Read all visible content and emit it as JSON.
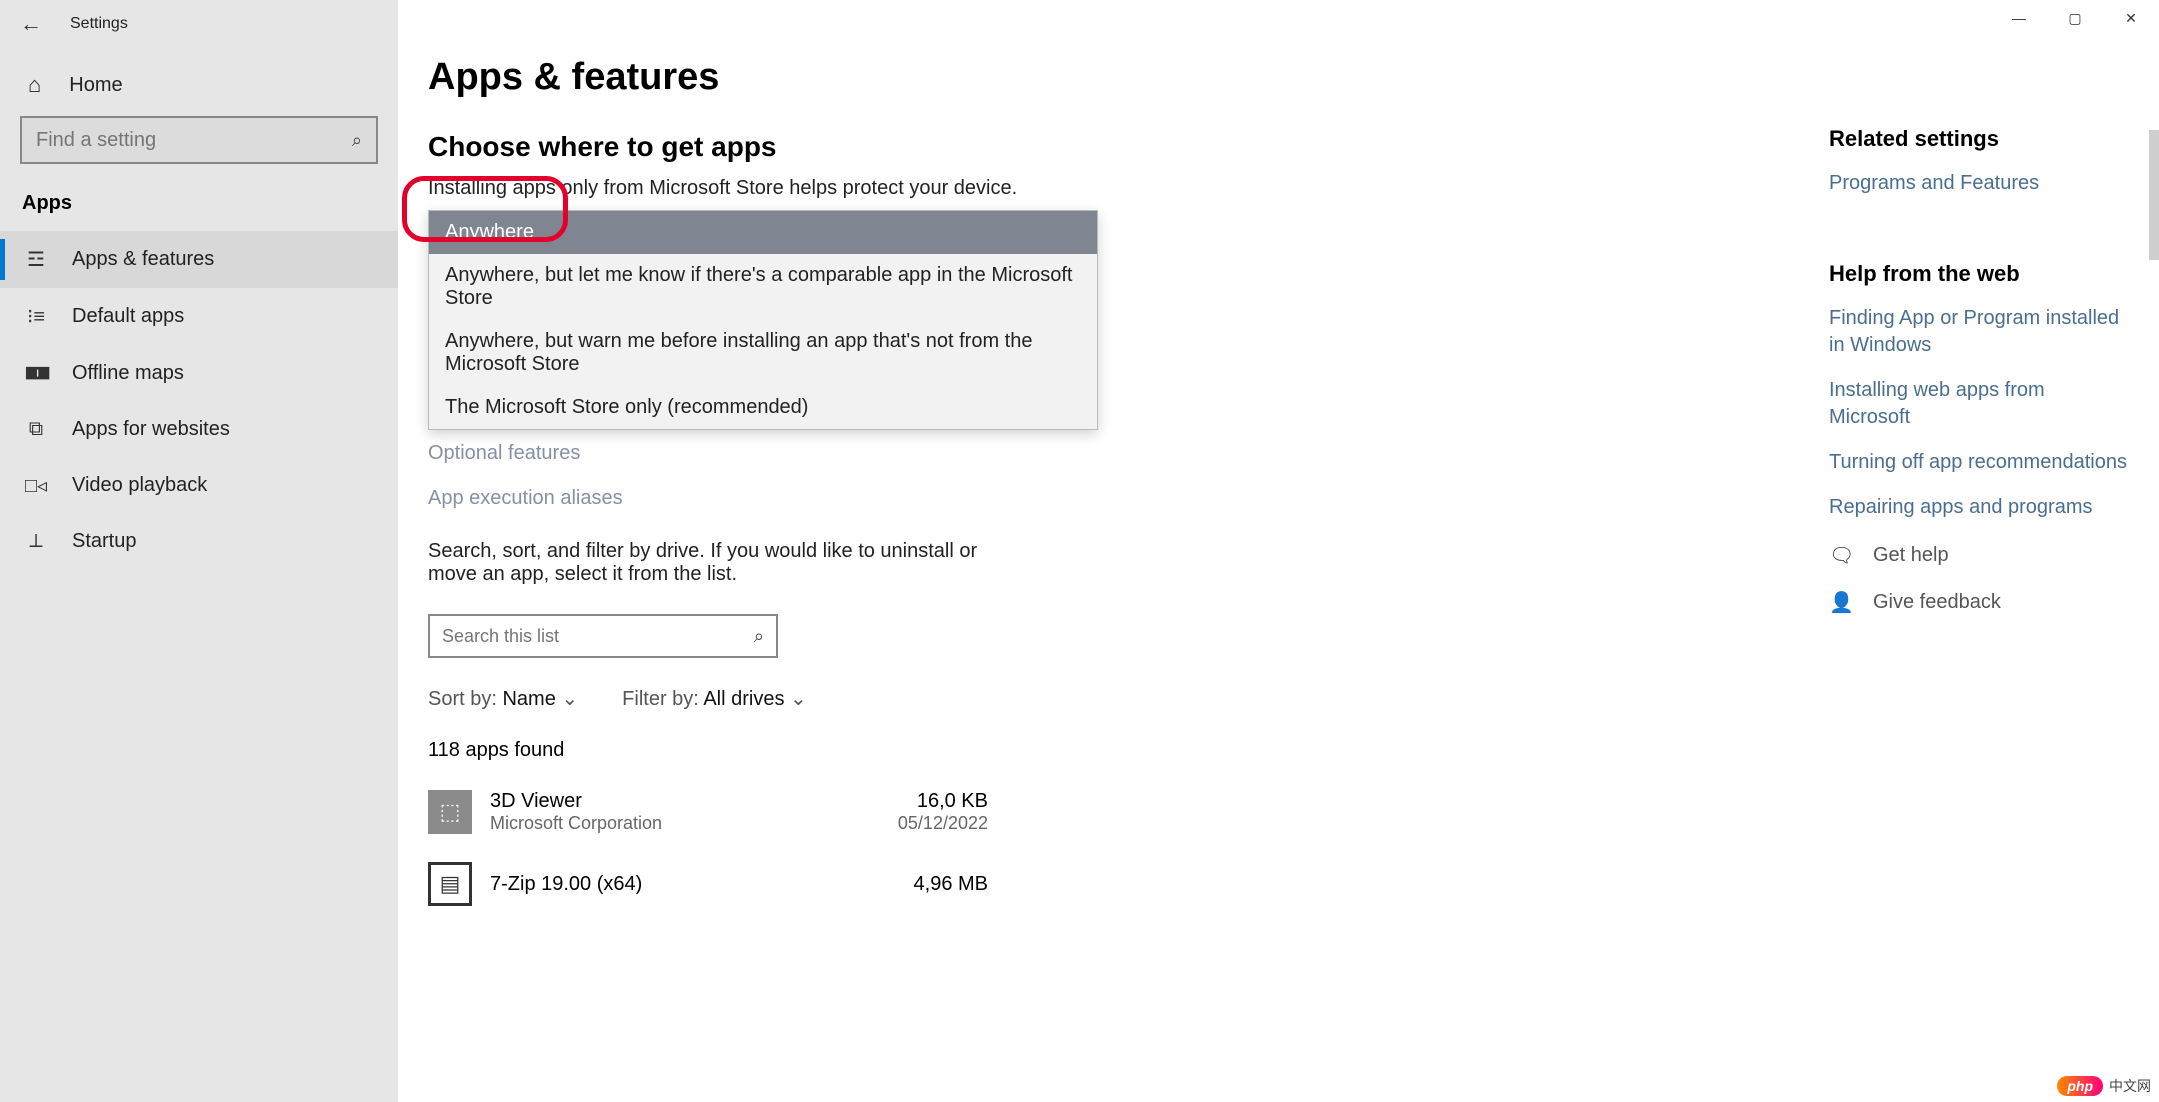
{
  "window": {
    "title": "Settings"
  },
  "sidebar": {
    "home": "Home",
    "search_placeholder": "Find a setting",
    "section": "Apps",
    "items": [
      {
        "icon": "apps-features-icon",
        "glyph": "☲",
        "label": "Apps & features",
        "selected": true
      },
      {
        "icon": "default-apps-icon",
        "glyph": "⁝≡",
        "label": "Default apps",
        "selected": false
      },
      {
        "icon": "offline-maps-icon",
        "glyph": "🀰",
        "label": "Offline maps",
        "selected": false
      },
      {
        "icon": "apps-websites-icon",
        "glyph": "⧉",
        "label": "Apps for websites",
        "selected": false
      },
      {
        "icon": "video-playback-icon",
        "glyph": "□◃",
        "label": "Video playback",
        "selected": false
      },
      {
        "icon": "startup-icon",
        "glyph": "⟂",
        "label": "Startup",
        "selected": false
      }
    ]
  },
  "main": {
    "h1": "Apps & features",
    "choose_h2": "Choose where to get apps",
    "choose_body": "Installing apps only from Microsoft Store helps protect your device.",
    "dropdown": {
      "selected": "Anywhere",
      "options": [
        "Anywhere",
        "Anywhere, but let me know if there's a comparable app in the Microsoft Store",
        "Anywhere, but warn me before installing an app that's not from the Microsoft Store",
        "The Microsoft Store only (recommended)"
      ]
    },
    "optional_link": "Optional features",
    "aliases_link": "App execution aliases",
    "list_body": "Search, sort, and filter by drive. If you would like to uninstall or move an app, select it from the list.",
    "list_search_placeholder": "Search this list",
    "sort_label": "Sort by:",
    "sort_value": "Name",
    "filter_label": "Filter by:",
    "filter_value": "All drives",
    "found": "118 apps found",
    "apps": [
      {
        "name": "3D Viewer",
        "publisher": "Microsoft Corporation",
        "size": "16,0 KB",
        "date": "05/12/2022"
      },
      {
        "name": "7-Zip 19.00 (x64)",
        "publisher": "",
        "size": "4,96 MB",
        "date": ""
      }
    ]
  },
  "right": {
    "related_h": "Related settings",
    "programs_link": "Programs and Features",
    "help_h": "Help from the web",
    "help_links": [
      "Finding App or Program installed in Windows",
      "Installing web apps from Microsoft",
      "Turning off app recommendations",
      "Repairing apps and programs"
    ],
    "get_help": "Get help",
    "feedback": "Give feedback"
  },
  "watermark": {
    "pill": "php",
    "text": "中文网"
  }
}
